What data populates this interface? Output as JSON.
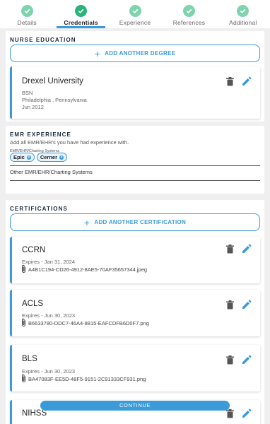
{
  "stepper": {
    "steps": [
      {
        "label": "Details"
      },
      {
        "label": "Credentials"
      },
      {
        "label": "Experience"
      },
      {
        "label": "References"
      },
      {
        "label": "Additional"
      }
    ]
  },
  "education": {
    "title": "NURSE EDUCATION",
    "add_label": "ADD ANOTHER DEGREE",
    "entries": [
      {
        "school": "Drexel University",
        "degree": "BSN",
        "location": "Philadelphia , Pennsylvania",
        "date": "Jun 2012"
      }
    ]
  },
  "emr": {
    "title": "EMR EXPERIENCE",
    "description": "Add all EMR/EHR's you have had experience with.",
    "field_label": "EMR/EHR/Charting Systems",
    "chips": [
      "Epic",
      "Cerner"
    ],
    "other_label": "Other EMR/EHR/Charting Systems"
  },
  "certifications": {
    "title": "CERTIFICATIONS",
    "add_label": "ADD ANOTHER CERTIFICATION",
    "entries": [
      {
        "name": "CCRN",
        "expires": "Expires - Jan 31, 2024",
        "file": "A4B1C194-CD26-4912-8AE5-70AF35657344.jpeg"
      },
      {
        "name": "ACLS",
        "expires": "Expires - Jun 30, 2023",
        "file": "B6633780-DDC7-46A4-8815-EAFCDFB6D0F7.png"
      },
      {
        "name": "BLS",
        "expires": "Expires - Jun 30, 2023",
        "file": "BA47083F-EE5D-48F5-9151-2C91333CF931.png"
      },
      {
        "name": "NIHSS"
      }
    ]
  },
  "footer": {
    "continue_label": "CONTINUE"
  },
  "colors": {
    "accent": "#3a9bd8",
    "step_done": "#7fd3ae",
    "step_active": "#27b37a"
  }
}
